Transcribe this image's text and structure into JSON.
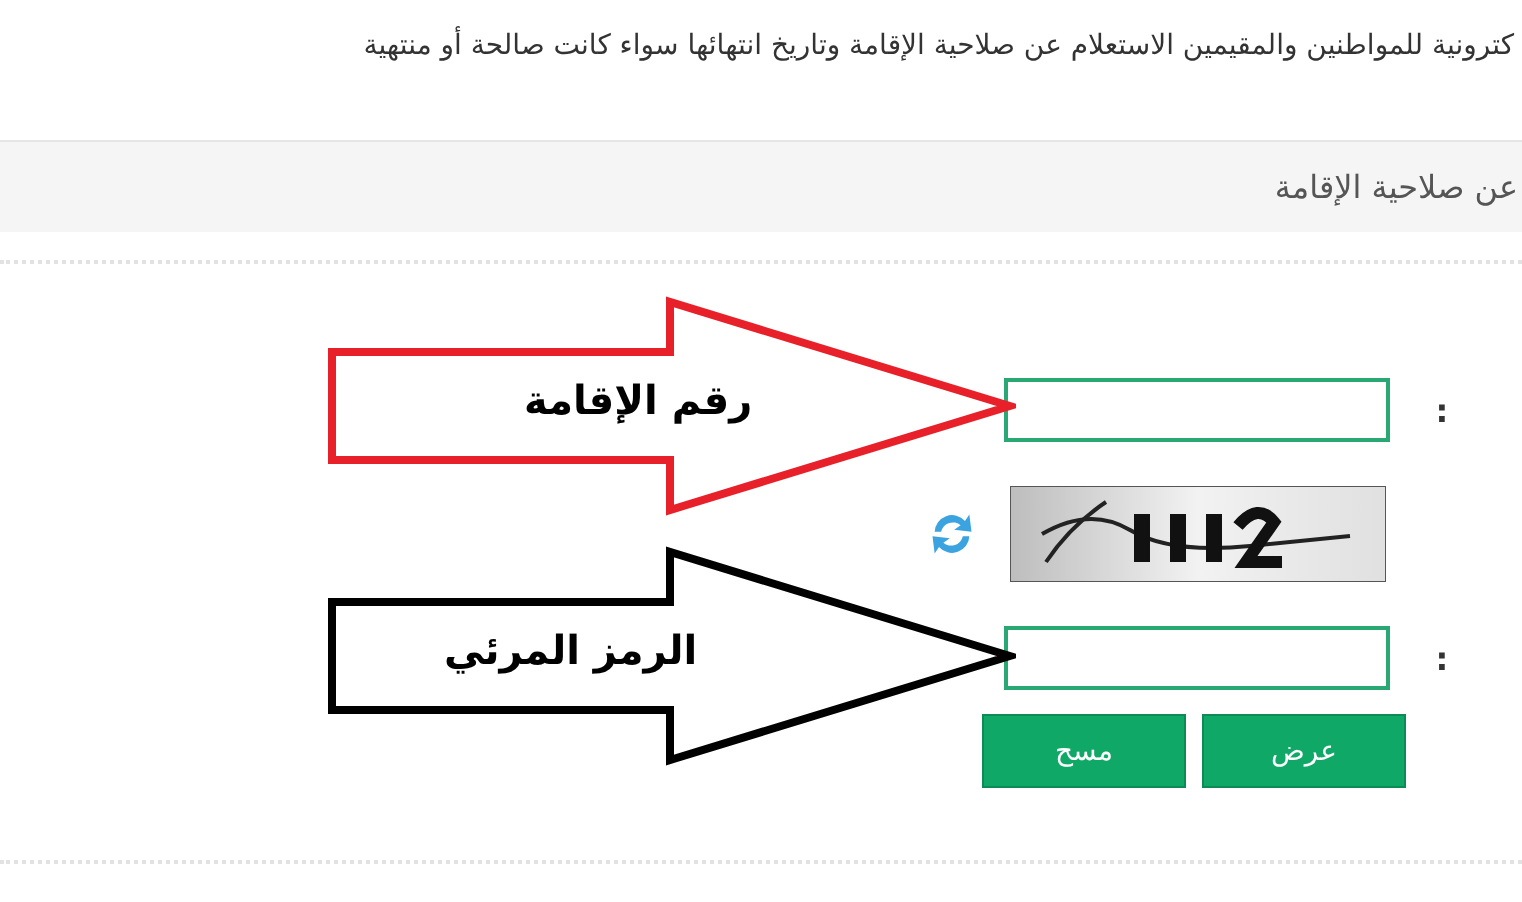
{
  "intro_text": "كترونية للمواطنين والمقيمين الاستعلام عن صلاحية الإقامة وتاريخ انتهائها سواء كانت صالحة أو منتهية",
  "section_header": "عن صلاحية الإقامة",
  "form": {
    "rows": [
      {
        "kind": "input",
        "label": ":"
      },
      {
        "kind": "captcha"
      },
      {
        "kind": "input",
        "label": ":"
      }
    ],
    "buttons": [
      "عرض",
      "مسح"
    ]
  },
  "annotations": [
    {
      "label": "رقم الإقامة",
      "color": "#e8202a"
    },
    {
      "label": "الرمز المرئي",
      "color": "#000000"
    }
  ]
}
